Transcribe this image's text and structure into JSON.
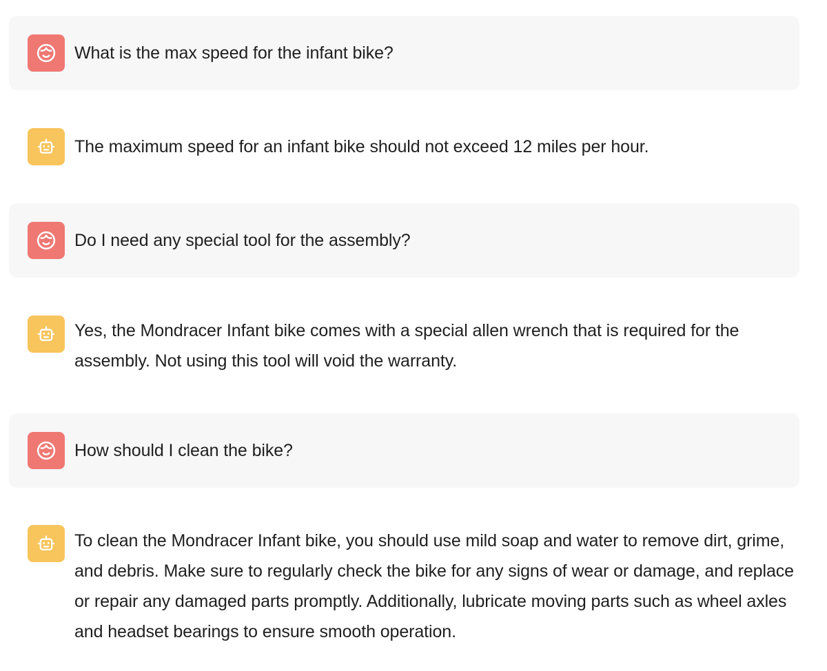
{
  "conversation": {
    "colors": {
      "user_avatar": "#ef7873",
      "bot_avatar": "#f8c45c",
      "user_bubble": "#f7f7f8"
    },
    "messages": [
      {
        "role": "user",
        "icon": "user-face-icon",
        "text": "What is the max speed for the infant bike?"
      },
      {
        "role": "assistant",
        "icon": "robot-icon",
        "text": "The maximum speed for an infant bike should not exceed 12 miles per hour."
      },
      {
        "role": "user",
        "icon": "user-face-icon",
        "text": "Do I need any special tool for the assembly?"
      },
      {
        "role": "assistant",
        "icon": "robot-icon",
        "text": "Yes, the Mondracer Infant bike comes with a special allen wrench that is required for the assembly. Not using this tool will void the warranty."
      },
      {
        "role": "user",
        "icon": "user-face-icon",
        "text": "How should I clean the bike?"
      },
      {
        "role": "assistant",
        "icon": "robot-icon",
        "text": "To clean the Mondracer Infant bike, you should use mild soap and water to remove dirt, grime, and debris. Make sure to regularly check the bike for any signs of wear or damage, and replace or repair any damaged parts promptly. Additionally, lubricate moving parts such as wheel axles and headset bearings to ensure smooth operation."
      }
    ]
  }
}
